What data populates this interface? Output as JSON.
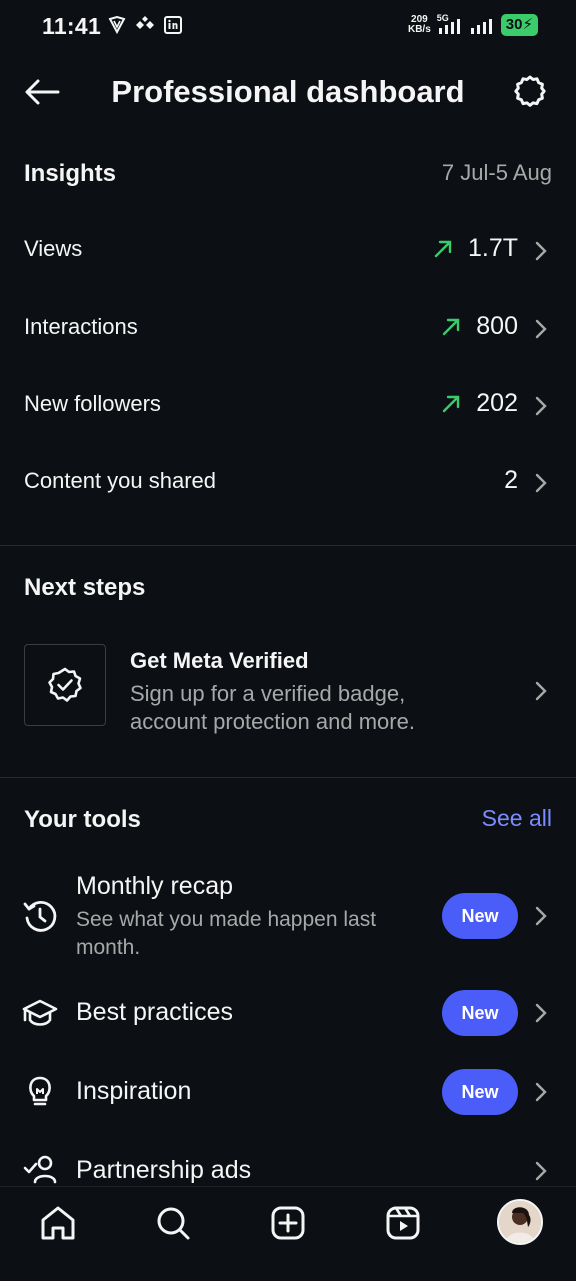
{
  "status_bar": {
    "time": "11:41",
    "net_speed_value": "209",
    "net_speed_unit": "KB/s",
    "network": "5G",
    "battery": "30"
  },
  "header": {
    "title": "Professional dashboard"
  },
  "insights": {
    "title": "Insights",
    "date_range": "7 Jul-5 Aug",
    "rows": [
      {
        "label": "Views",
        "value": "1.7T",
        "trend": "up"
      },
      {
        "label": "Interactions",
        "value": "800",
        "trend": "up"
      },
      {
        "label": "New followers",
        "value": "202",
        "trend": "up"
      },
      {
        "label": "Content you shared",
        "value": "2",
        "trend": "none"
      }
    ]
  },
  "next_steps": {
    "title": "Next steps",
    "card": {
      "title": "Get Meta Verified",
      "description": "Sign up for a verified badge, account protection and more."
    }
  },
  "tools": {
    "title": "Your tools",
    "see_all": "See all",
    "items": [
      {
        "title": "Monthly recap",
        "description": "See what you made happen last month.",
        "badge": "New",
        "icon": "history-icon"
      },
      {
        "title": "Best practices",
        "badge": "New",
        "icon": "graduation-cap-icon"
      },
      {
        "title": "Inspiration",
        "badge": "New",
        "icon": "lightbulb-icon"
      },
      {
        "title": "Partnership ads",
        "icon": "partnership-icon"
      }
    ]
  },
  "colors": {
    "background": "#0c1014",
    "accent": "#4a5df9",
    "link": "#7c8bff",
    "trend_up": "#3ccb6b"
  }
}
